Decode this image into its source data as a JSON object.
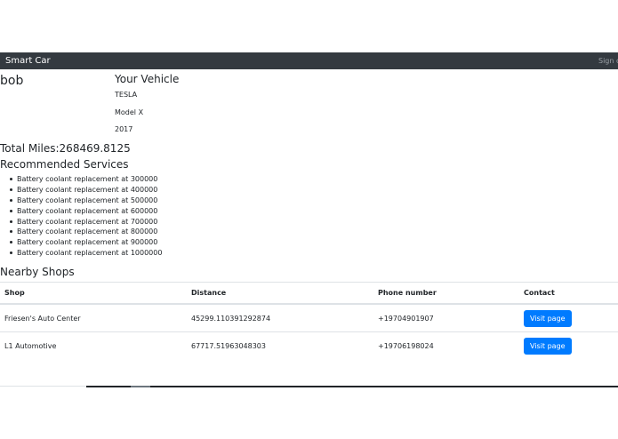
{
  "navbar": {
    "brand": "Smart Car",
    "signout": "Sign out"
  },
  "user": {
    "name": "bob"
  },
  "vehicle": {
    "heading": "Your Vehicle",
    "make": "TESLA",
    "model": "Model X",
    "year": "2017"
  },
  "miles": {
    "label": "Total Miles:",
    "value": "268469.8125"
  },
  "services": {
    "heading": "Recommended Services",
    "items": [
      "Battery coolant replacement at 300000",
      "Battery coolant replacement at 400000",
      "Battery coolant replacement at 500000",
      "Battery coolant replacement at 600000",
      "Battery coolant replacement at 700000",
      "Battery coolant replacement at 800000",
      "Battery coolant replacement at 900000",
      "Battery coolant replacement at 1000000"
    ]
  },
  "shops": {
    "heading": "Nearby Shops",
    "columns": [
      "Shop",
      "Distance",
      "Phone number",
      "Contact"
    ],
    "rows": [
      {
        "name": "Friesen's Auto Center",
        "distance": "45299.110391292874",
        "phone": "+19704901907",
        "action": "Visit page"
      },
      {
        "name": "L1 Automotive",
        "distance": "67717.51963048303",
        "phone": "+19706198024",
        "action": "Visit page"
      }
    ]
  },
  "colors": {
    "navbar": "#343a40",
    "primary_button": "#007bff"
  }
}
